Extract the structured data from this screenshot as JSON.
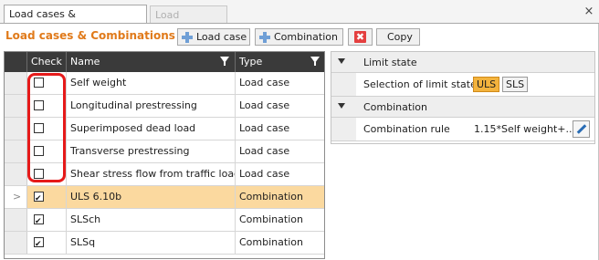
{
  "tabs": [
    {
      "label": "Load cases & Combinations",
      "active": true
    },
    {
      "label": "Load impulses",
      "active": false
    }
  ],
  "close_glyph": "×",
  "toolbar": {
    "title": "Load cases & Combinations",
    "add_load_case_label": "Load case",
    "add_combination_label": "Combination",
    "delete_glyph": "✖",
    "copy_label": "Copy"
  },
  "grid": {
    "headers": {
      "check": "Check",
      "name": "Name",
      "type": "Type"
    },
    "current_row_glyph": ">",
    "rows": [
      {
        "checked": false,
        "name": "Self weight",
        "type": "Load case",
        "selected": false
      },
      {
        "checked": false,
        "name": "Longitudinal prestressing",
        "type": "Load case",
        "selected": false
      },
      {
        "checked": false,
        "name": "Superimposed dead load",
        "type": "Load case",
        "selected": false
      },
      {
        "checked": false,
        "name": "Transverse prestressing",
        "type": "Load case",
        "selected": false
      },
      {
        "checked": false,
        "name": "Shear stress flow from traffic load",
        "type": "Load case",
        "selected": false
      },
      {
        "checked": true,
        "name": "ULS 6.10b",
        "type": "Combination",
        "selected": true
      },
      {
        "checked": true,
        "name": "SLSch",
        "type": "Combination",
        "selected": false
      },
      {
        "checked": true,
        "name": "SLSq",
        "type": "Combination",
        "selected": false
      }
    ]
  },
  "properties": {
    "limit_state": {
      "section_title": "Limit state",
      "label": "Selection of limit state",
      "options": [
        "ULS",
        "SLS"
      ],
      "selected": "ULS"
    },
    "combination": {
      "section_title": "Combination",
      "label": "Combination rule",
      "value": "1.15*Self weight+..."
    }
  },
  "colors": {
    "accent_orange": "#e07a1a",
    "selected_row": "#fbd99f",
    "annotation_red": "#e61a1a",
    "header_dark": "#3a3a3a"
  },
  "icons": [
    "plus-icon",
    "delete-icon",
    "filter-icon",
    "collapse-icon",
    "edit-icon"
  ]
}
